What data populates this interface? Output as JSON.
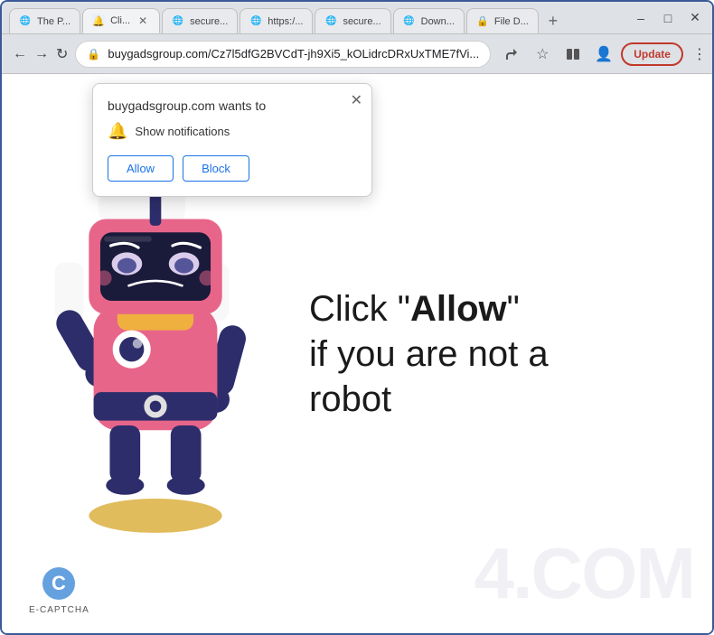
{
  "browser": {
    "tabs": [
      {
        "id": "tab1",
        "label": "The P...",
        "favicon": "🌐",
        "active": false
      },
      {
        "id": "tab2",
        "label": "Cli...",
        "favicon": "🔔",
        "active": true
      },
      {
        "id": "tab3",
        "label": "secure...",
        "favicon": "🌐",
        "active": false
      },
      {
        "id": "tab4",
        "label": "https:/...",
        "favicon": "🌐",
        "active": false
      },
      {
        "id": "tab5",
        "label": "secure...",
        "favicon": "🌐",
        "active": false
      },
      {
        "id": "tab6",
        "label": "Down...",
        "favicon": "🌐",
        "active": false
      },
      {
        "id": "tab7",
        "label": "File D...",
        "favicon": "🔒",
        "active": false
      }
    ],
    "url": "buygadsgroup.com/Cz7l5dfG2BVCdT-jh9Xi5_kOLidrcDRxUxTME7fVi...",
    "update_label": "Update"
  },
  "popup": {
    "title": "buygadsgroup.com wants to",
    "notification_text": "Show notifications",
    "allow_label": "Allow",
    "block_label": "Block"
  },
  "page": {
    "caption_line1": "Click \"",
    "caption_allow": "Allow",
    "caption_line1_end": "\"",
    "caption_line2": "if you are not a",
    "caption_line3": "robot",
    "watermark": "4.COM",
    "ecaptcha_label": "E-CAPTCHA"
  }
}
